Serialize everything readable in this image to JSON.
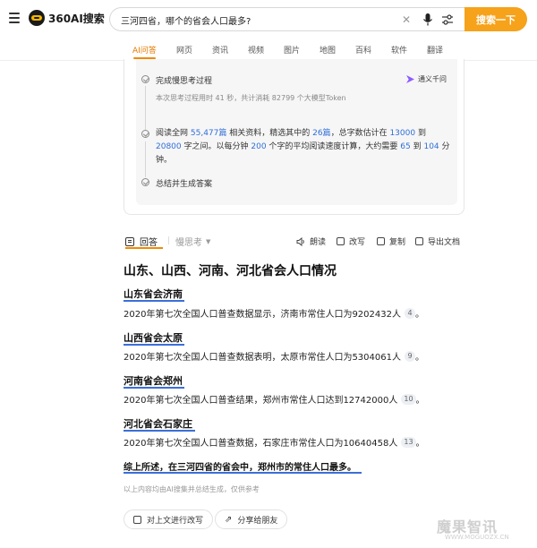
{
  "header": {
    "brand": "360AI搜索",
    "search_value": "三河四省，哪个的省会人口最多?",
    "search_button": "搜索一下"
  },
  "tabs": [
    {
      "label": "AI问答",
      "active": true
    },
    {
      "label": "网页"
    },
    {
      "label": "资讯"
    },
    {
      "label": "视频"
    },
    {
      "label": "图片"
    },
    {
      "label": "地图"
    },
    {
      "label": "百科"
    },
    {
      "label": "软件"
    },
    {
      "label": "翻译"
    }
  ],
  "thinking": {
    "step1_title": "完成慢思考过程",
    "step1_sub": "本次思考过程用时 41 秒，共计消耗 82799 个大模型Token",
    "model": "通义千问",
    "step2": {
      "p1": "阅读全网 ",
      "n1": "55,477篇",
      "p2": " 相关资料，精选其中的 ",
      "n2": "26篇",
      "p3": "，总字数估计在 ",
      "n3": "13000",
      "p4": " 到 ",
      "n4": "20800",
      "p5": " 字之间。以每分钟 ",
      "n5": "200",
      "p6": " 个字的平均阅读速度计算，大约需要 ",
      "n6": "65",
      "p7": " 到 ",
      "n7": "104",
      "p8": " 分钟。"
    },
    "step3_title": "总结并生成答案"
  },
  "answer_header": {
    "answer_tab": "回答",
    "slow_tab": "慢思考",
    "actions": [
      "朗读",
      "改写",
      "复制",
      "导出文档"
    ]
  },
  "answer": {
    "title": "山东、山西、河南、河北省会人口情况",
    "sections": [
      {
        "heading": "山东省会济南",
        "body": "2020年第七次全国人口普查数据显示，济南市常住人口为9202432人",
        "cite": "4"
      },
      {
        "heading": "山西省会太原",
        "body": "2020年第七次全国人口普查数据表明，太原市常住人口为5304061人",
        "cite": "9"
      },
      {
        "heading": "河南省会郑州",
        "body": "2020年第七次全国人口普查结果，郑州市常住人口达到12742000人",
        "cite": "10"
      },
      {
        "heading": "河北省会石家庄",
        "body": "2020年第七次全国人口普查数据，石家庄市常住人口为10640458人",
        "cite": "13"
      }
    ],
    "summary": "综上所述，在三河四省的省会中，郑州市的常住人口最多。",
    "disclaimer": "以上内容均由AI搜集并总结生成，仅供参考",
    "buttons": [
      "对上文进行改写",
      "分享给朋友"
    ]
  },
  "watermark": {
    "text": "魔果智讯",
    "sub": "WWW.MOGUOZX.CN"
  }
}
